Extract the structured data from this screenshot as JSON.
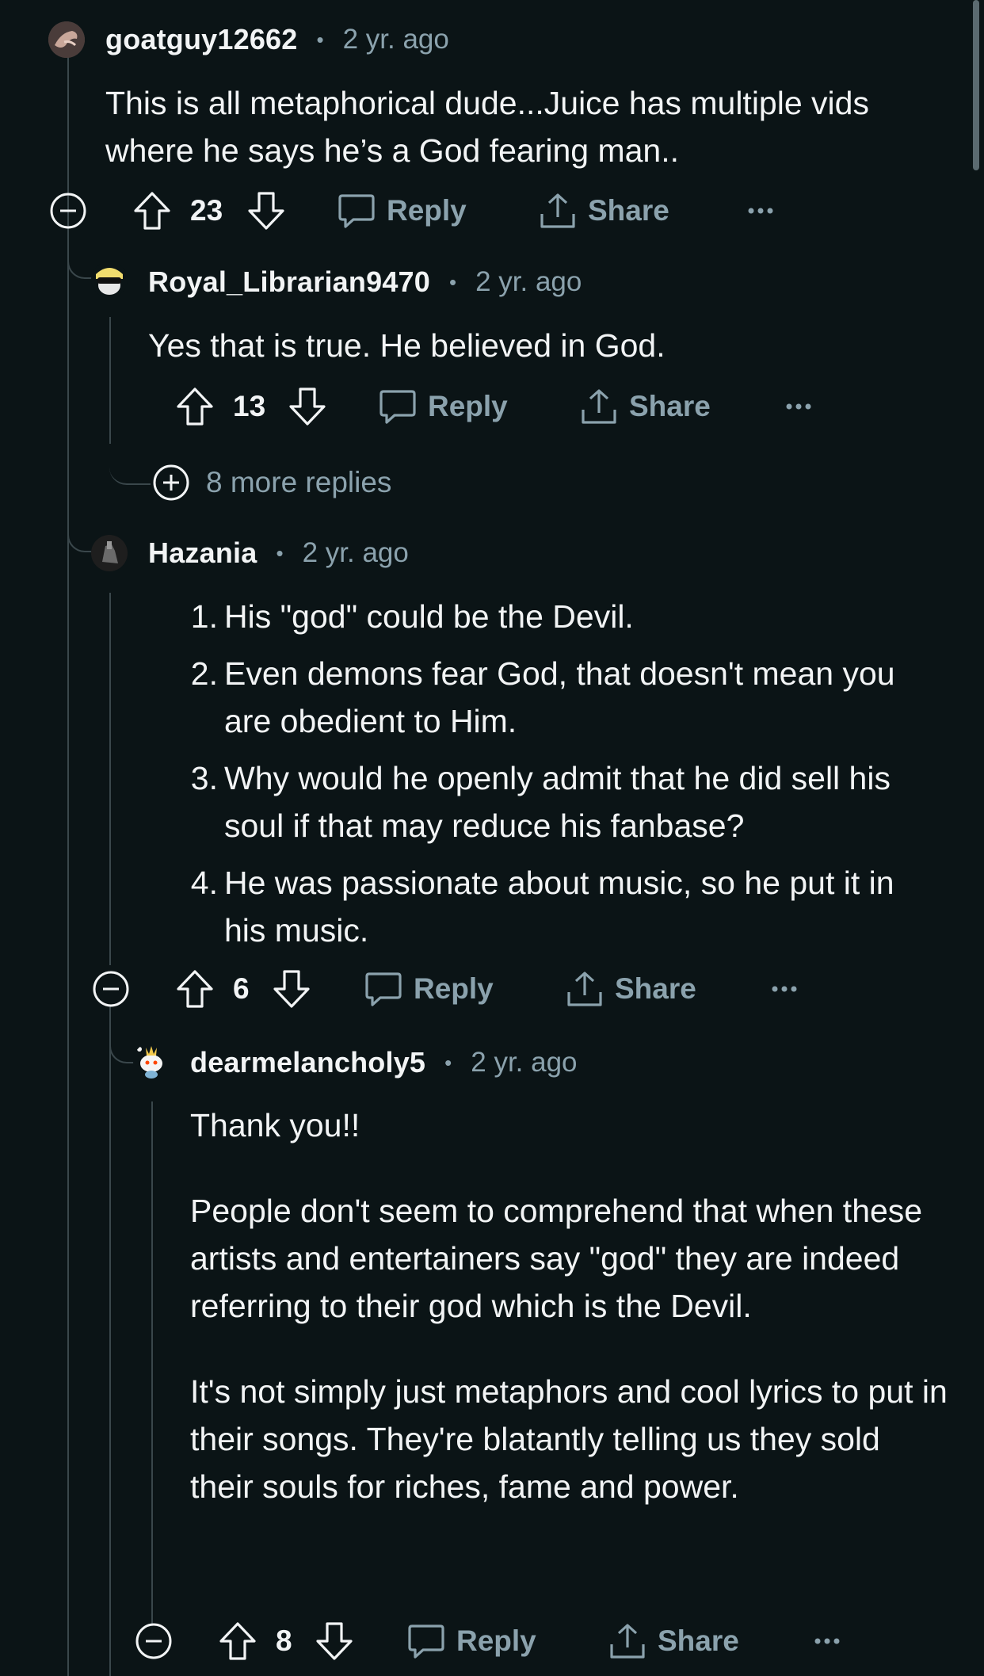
{
  "colors": {
    "background": "#0b1416",
    "text": "#f2f4f5",
    "muted": "#8ba2ad",
    "thread_line": "#3a474b"
  },
  "comments": [
    {
      "username": "goatguy12662",
      "separator": "•",
      "time": "2 yr. ago",
      "body": [
        "This is all metaphorical dude...Juice has multiple vids where he says he’s a God fearing man.."
      ],
      "votes": "23",
      "reply_label": "Reply",
      "share_label": "Share",
      "icons": [
        "collapse-icon",
        "upvote-icon",
        "downvote-icon",
        "reply-bubble-icon",
        "share-icon",
        "more-icon"
      ]
    },
    {
      "username": "Royal_Librarian9470",
      "separator": "•",
      "time": "2 yr. ago",
      "body": [
        "Yes that is true. He believed in God."
      ],
      "votes": "13",
      "reply_label": "Reply",
      "share_label": "Share",
      "more_replies": "8 more replies"
    },
    {
      "username": "Hazania",
      "separator": "•",
      "time": "2 yr. ago",
      "list": [
        {
          "num": "1.",
          "text": "His \"god\" could be the Devil."
        },
        {
          "num": "2.",
          "text": "Even demons fear God, that doesn't mean you are obedient to Him."
        },
        {
          "num": "3.",
          "text": "Why would he openly admit that he did sell his soul if that may reduce his fanbase?"
        },
        {
          "num": "4.",
          "text": "He was passionate about music, so he put it in his music."
        }
      ],
      "votes": "6",
      "reply_label": "Reply",
      "share_label": "Share"
    },
    {
      "username": "dearmelancholy5",
      "separator": "•",
      "time": "2 yr. ago",
      "body": [
        "Thank you!!",
        "People don't seem to comprehend that when these artists and entertainers say \"god\" they are indeed referring to their god which is the Devil.",
        "It's not simply just metaphors and cool lyrics to put in their songs. They're blatantly telling us they sold their souls for riches, fame and power."
      ],
      "votes": "8",
      "reply_label": "Reply",
      "share_label": "Share"
    }
  ]
}
